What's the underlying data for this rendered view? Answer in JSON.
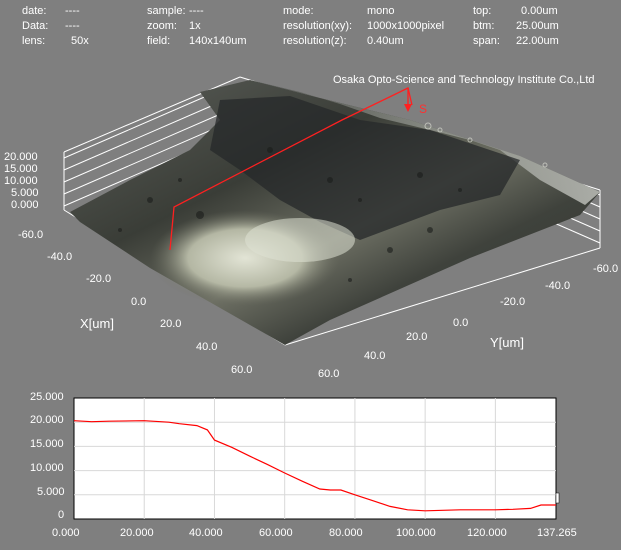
{
  "meta": {
    "date": {
      "key": "date:",
      "value": "----"
    },
    "data": {
      "key": "Data:",
      "value": "----"
    },
    "lens": {
      "key": "lens:",
      "value": "50x"
    },
    "sample": {
      "key": "sample:",
      "value": "----"
    },
    "zoom": {
      "key": "zoom:",
      "value": "1x"
    },
    "field": {
      "key": "field:",
      "value": "140x140um"
    },
    "mode": {
      "key": "mode:",
      "value": "mono"
    },
    "res_xy": {
      "key": "resolution(xy):",
      "value": "1000x1000pixel"
    },
    "res_z": {
      "key": "resolution(z):",
      "value": "0.40um"
    },
    "top": {
      "key": "top:",
      "value": "0.00um"
    },
    "btm": {
      "key": "btm:",
      "value": "25.00um"
    },
    "span": {
      "key": "span:",
      "value": "22.00um"
    }
  },
  "surface": {
    "vendor": "Osaka Opto-Science and Technology Institute Co.,Ltd",
    "section_marker": "S",
    "z_ticks": [
      "20.000",
      "15.000",
      "10.000",
      "5.000",
      "0.000"
    ],
    "x_ticks": [
      "-60.0",
      "-40.0",
      "-20.0",
      "0.0",
      "20.0",
      "40.0",
      "60.0"
    ],
    "y_ticks": [
      "-60.0",
      "-40.0",
      "-20.0",
      "0.0",
      "20.0",
      "40.0",
      "60.0"
    ],
    "x_label": "X[um]",
    "y_label": "Y[um]"
  },
  "chart_data": {
    "type": "line",
    "x_ticks": [
      "0.000",
      "20.000",
      "40.000",
      "60.000",
      "80.000",
      "100.000",
      "120.000",
      "137.265"
    ],
    "y_ticks": [
      "25.000",
      "20.000",
      "15.000",
      "10.000",
      "5.000",
      "0"
    ],
    "xlim": [
      0,
      137.265
    ],
    "ylim": [
      0,
      25
    ],
    "series_color": "#ff0000",
    "x": [
      0,
      5,
      10,
      20,
      27,
      30,
      35,
      38,
      40,
      45,
      50,
      55,
      60,
      65,
      70,
      73,
      76,
      80,
      85,
      90,
      95,
      100,
      105,
      110,
      115,
      120,
      125,
      130,
      133,
      137.265
    ],
    "y": [
      20.3,
      20.1,
      20.2,
      20.3,
      20.0,
      19.7,
      19.3,
      18.4,
      16.3,
      14.8,
      13.0,
      11.3,
      9.5,
      7.8,
      6.2,
      6.0,
      6.0,
      5.0,
      3.8,
      2.6,
      1.9,
      1.7,
      1.8,
      1.9,
      1.9,
      1.9,
      2.0,
      2.2,
      2.9,
      2.9
    ]
  }
}
